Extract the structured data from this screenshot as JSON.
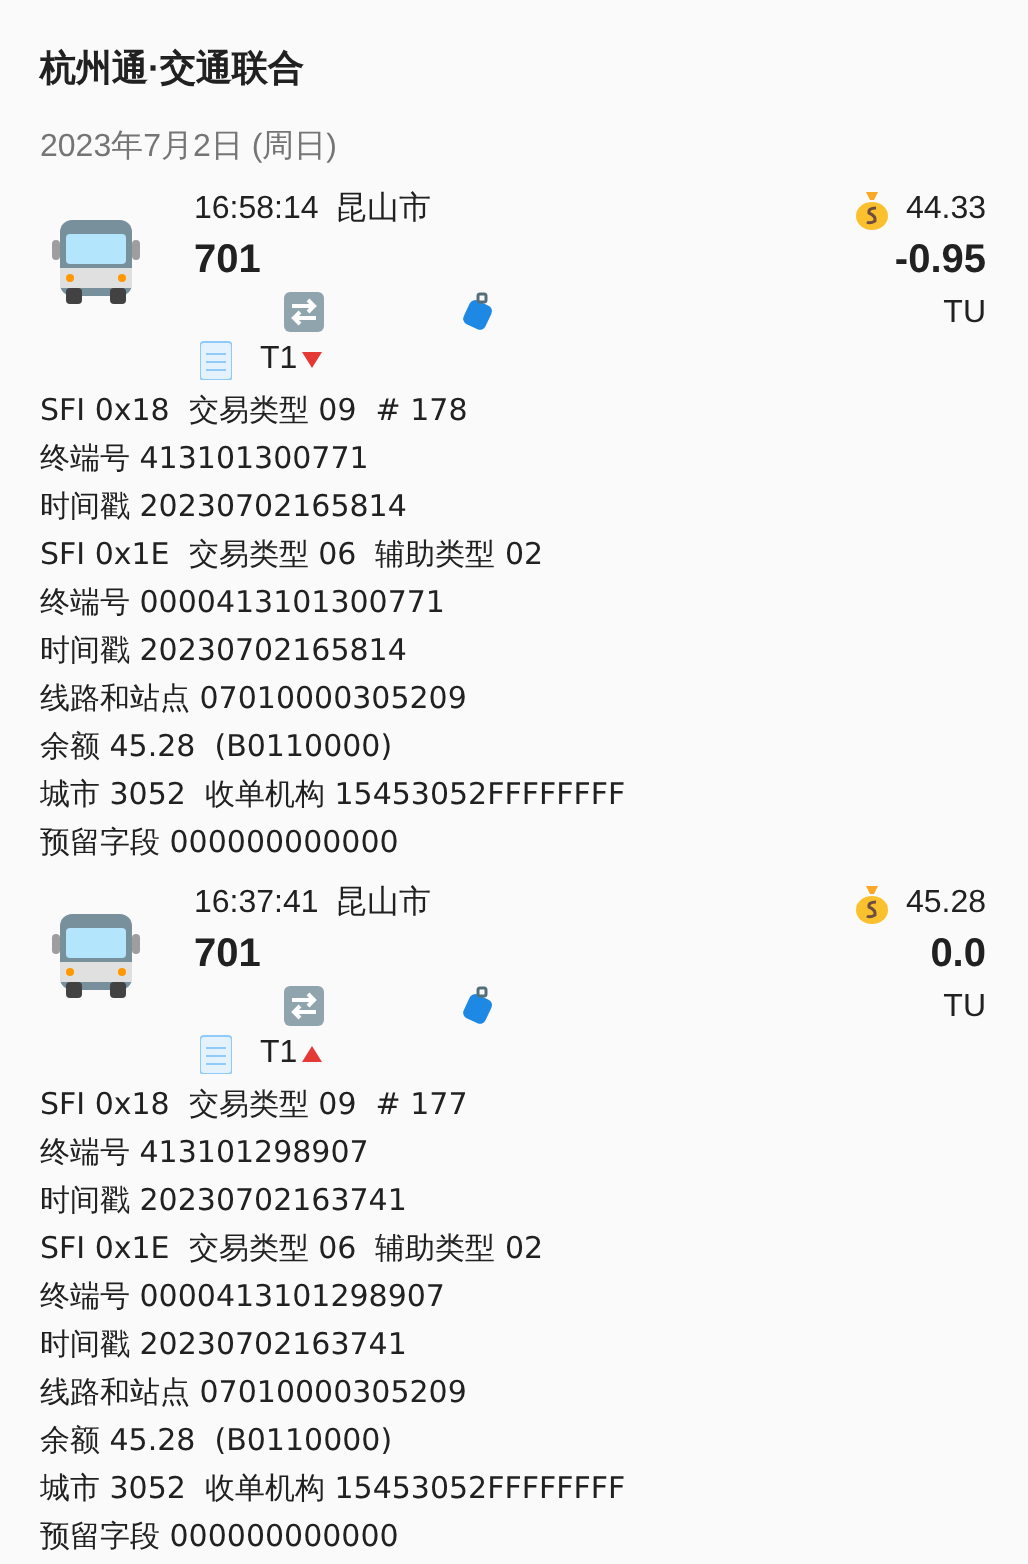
{
  "title": "杭州通·交通联合",
  "date": "2023年7月2日 (周日)",
  "records": [
    {
      "time": "16:58:14",
      "city": "昆山市",
      "route": "701",
      "balance": "44.33",
      "amount": "-0.95",
      "unit": "TU",
      "transfer_label": "T1",
      "falling": true,
      "details": [
        "SFI 0x18  交易类型 09  # 178",
        "终端号 413101300771",
        "时间戳 20230702165814",
        "SFI 0x1E  交易类型 06  辅助类型 02",
        "终端号 0000413101300771",
        "时间戳 20230702165814",
        "线路和站点 07010000305209",
        "余额 45.28  (B0110000)",
        "城市 3052  收单机构 15453052FFFFFFFF",
        "预留字段 000000000000"
      ]
    },
    {
      "time": "16:37:41",
      "city": "昆山市",
      "route": "701",
      "balance": "45.28",
      "amount": "0.0",
      "unit": "TU",
      "transfer_label": "T1",
      "falling": false,
      "details": [
        "SFI 0x18  交易类型 09  # 177",
        "终端号 413101298907",
        "时间戳 20230702163741",
        "SFI 0x1E  交易类型 06  辅助类型 02",
        "终端号 0000413101298907",
        "时间戳 20230702163741",
        "线路和站点 07010000305209",
        "余额 45.28  (B0110000)",
        "城市 3052  收单机构 15453052FFFFFFFF",
        "预留字段 000000000000"
      ]
    }
  ]
}
